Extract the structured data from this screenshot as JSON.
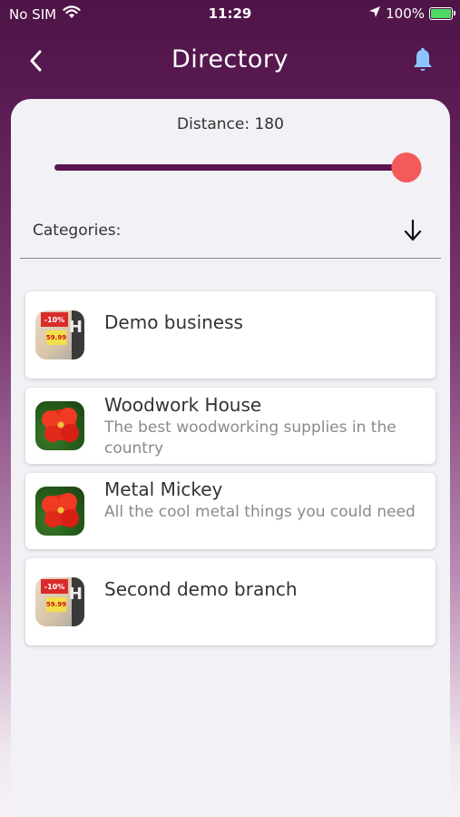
{
  "status_bar": {
    "carrier": "No SIM",
    "time": "11:29",
    "battery": "100%"
  },
  "header": {
    "title": "Directory"
  },
  "filters": {
    "distance_label": "Distance: 180",
    "distance_slider_level": 0.96,
    "categories_label": "Categories:"
  },
  "businesses": [
    {
      "name": "Demo business",
      "description": "",
      "image": "price-tag-photo"
    },
    {
      "name": "Woodwork House",
      "description": "The best woodworking supplies in the country",
      "image": "red-flower-photo"
    },
    {
      "name": "Metal Mickey",
      "description": "All the cool metal things you could need",
      "image": "red-flower-photo"
    },
    {
      "name": "Second demo branch",
      "description": "",
      "image": "price-tag-photo"
    }
  ],
  "colors": {
    "header_purple": "#4e1447",
    "slider_fill": "#5a1450",
    "slider_thumb": "#f45a5a"
  }
}
